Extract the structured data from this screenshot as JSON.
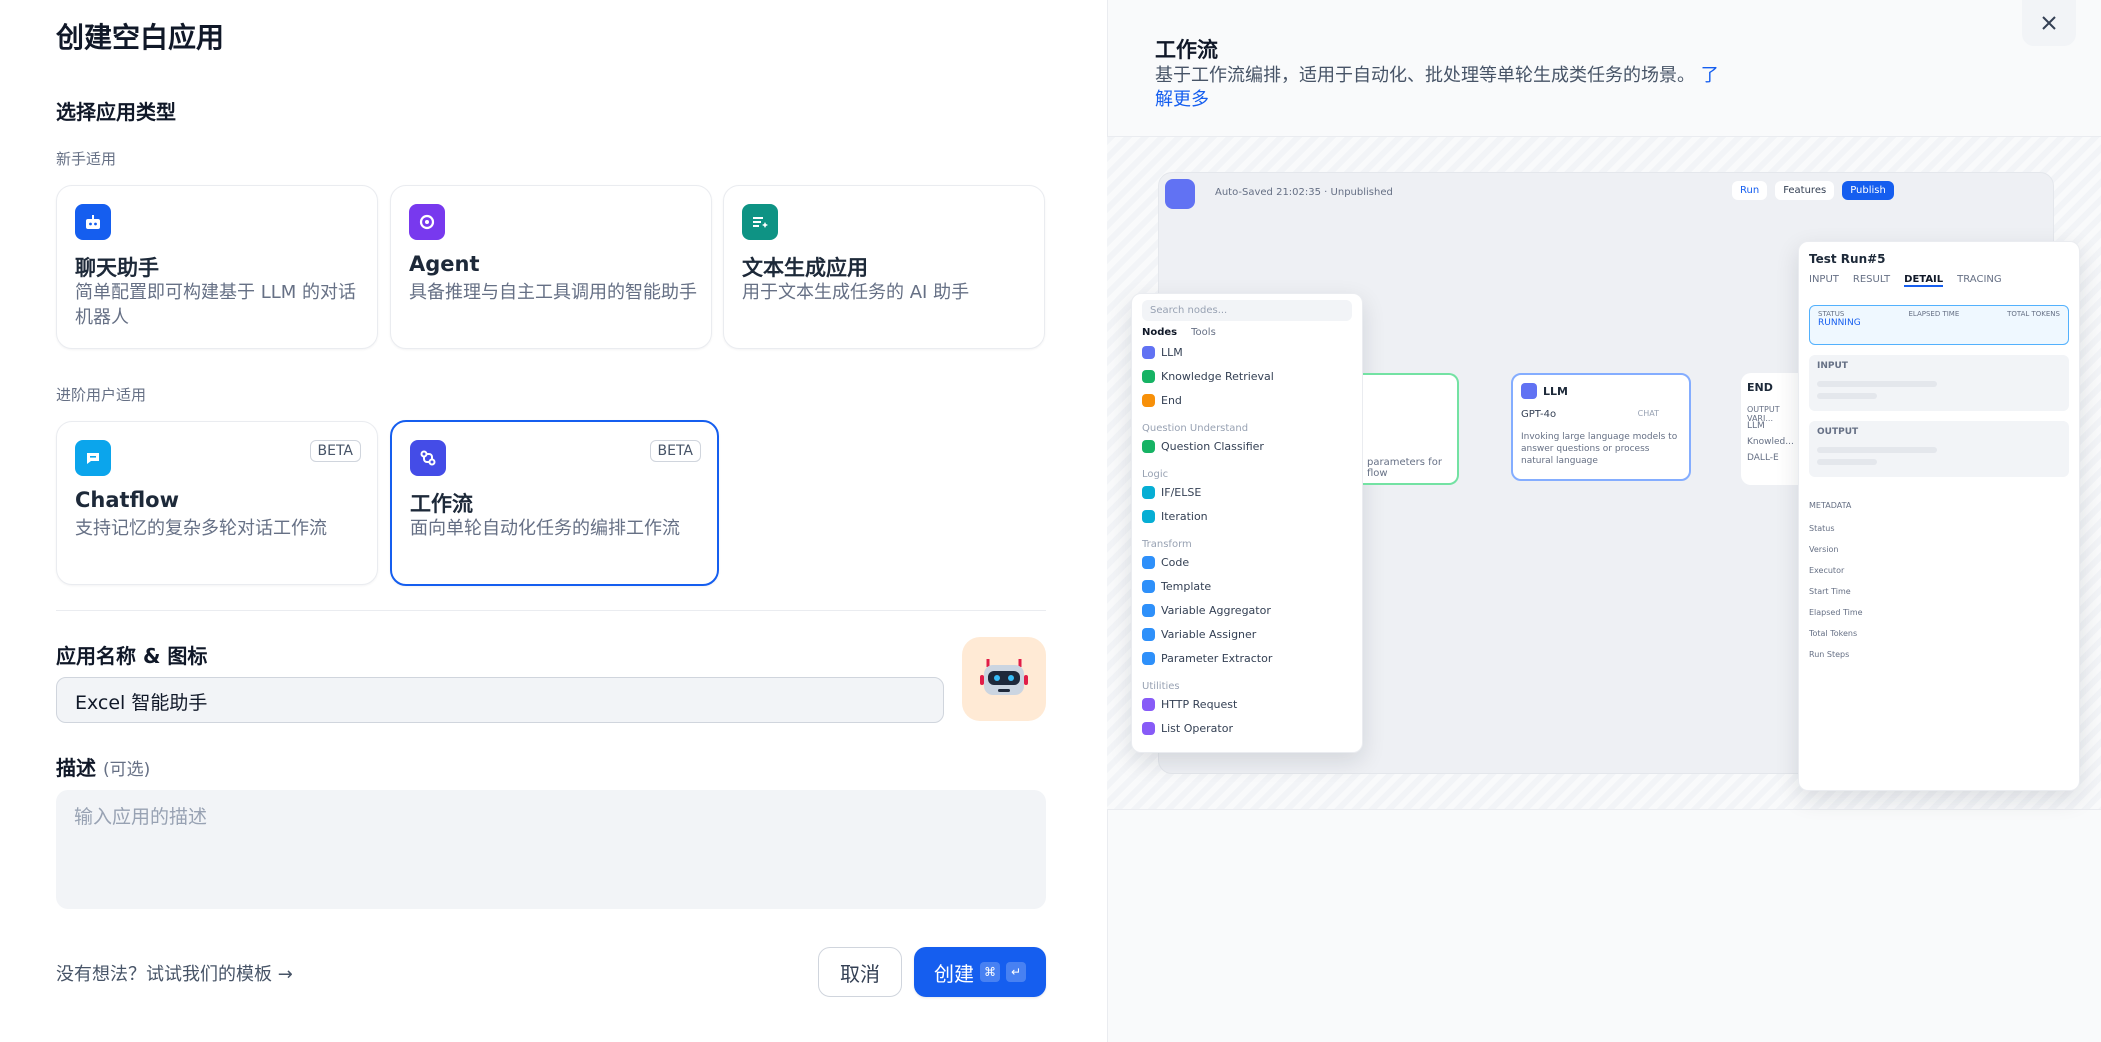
{
  "dialog": {
    "title": "创建空白应用"
  },
  "type_section": {
    "title": "选择应用类型",
    "beginner_label": "新手适用",
    "advanced_label": "进阶用户适用"
  },
  "cards": [
    {
      "title": "聊天助手",
      "desc": "简单配置即可构建基于 LLM 的对话机器人",
      "icon": "chat-bot-icon",
      "color": "#155eef"
    },
    {
      "title": "Agent",
      "desc": "具备推理与自主工具调用的智能助手",
      "icon": "agent-icon",
      "color": "#7839ee"
    },
    {
      "title": "文本生成应用",
      "desc": "用于文本生成任务的 AI 助手",
      "icon": "text-generation-icon",
      "color": "#0e9384"
    },
    {
      "title": "Chatflow",
      "desc": "支持记忆的复杂多轮对话工作流",
      "badge": "BETA",
      "icon": "chatflow-icon",
      "color": "#0ba5ec"
    },
    {
      "title": "工作流",
      "desc": "面向单轮自动化任务的编排工作流",
      "badge": "BETA",
      "icon": "workflow-icon",
      "color": "#444ce7"
    }
  ],
  "name_section": {
    "label": "应用名称 & 图标",
    "value": "Excel 智能助手",
    "avatar": "robot-avatar"
  },
  "desc_section": {
    "label": "描述",
    "optional": "(可选)",
    "placeholder": "输入应用的描述"
  },
  "footer": {
    "template_link": "没有想法？试试我们的模板",
    "cancel": "取消",
    "create": "创建",
    "shortcut_cmd": "⌘",
    "shortcut_enter": "↵"
  },
  "preview": {
    "title": "工作流",
    "desc": "基于工作流编排，适用于自动化、批处理等单轮生成类任务的场景。",
    "learn_more": "了解更多",
    "canvas": {
      "autosave": "Auto-Saved 21:02:35 · Unpublished",
      "run": "Run",
      "features": "Features",
      "publish": "Publish",
      "search_placeholder": "Search nodes...",
      "tabs": [
        "Nodes",
        "Tools"
      ],
      "node_groups": [
        {
          "group": "",
          "items": [
            "LLM",
            "Knowledge Retrieval",
            "End"
          ]
        },
        {
          "group": "Question Understand",
          "items": [
            "Question Classifier"
          ]
        },
        {
          "group": "Logic",
          "items": [
            "IF/ELSE",
            "Iteration"
          ]
        },
        {
          "group": "Transform",
          "items": [
            "Code",
            "Template",
            "Variable Aggregator",
            "Variable Assigner",
            "Parameter Extractor"
          ]
        },
        {
          "group": "Utilities",
          "items": [
            "HTTP Request",
            "List Operator"
          ]
        }
      ],
      "llm_node": {
        "title": "LLM",
        "model": "GPT-4o",
        "tag": "CHAT",
        "desc": "Invoking large language models to answer questions or process natural language"
      },
      "start_node_desc": "parameters for flow",
      "end_node": {
        "title": "END",
        "label": "OUTPUT VARI...",
        "outputs": [
          "LLM",
          "Knowled...",
          "DALL-E"
        ]
      },
      "run_panel": {
        "title": "Test Run#5",
        "tabs": [
          "INPUT",
          "RESULT",
          "DETAIL",
          "TRACING"
        ],
        "status_label": "STATUS",
        "status": "RUNNING",
        "elapsed_label": "ELAPSED TIME",
        "tokens_label": "TOTAL TOKENS",
        "input_label": "INPUT",
        "output_label": "OUTPUT",
        "metadata_label": "METADATA",
        "metadata_fields": [
          "Status",
          "Version",
          "Executor",
          "Start Time",
          "Elapsed Time",
          "Total Tokens",
          "Run Steps"
        ]
      }
    }
  }
}
